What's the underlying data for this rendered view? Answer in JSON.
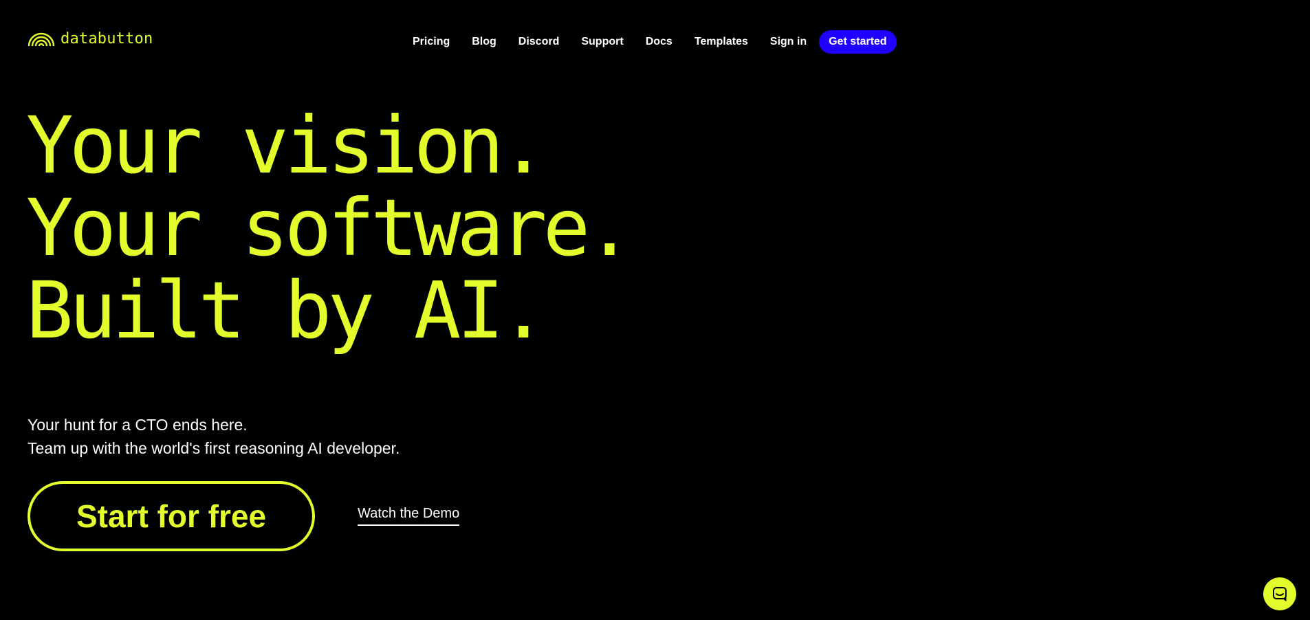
{
  "brand": {
    "name": "databutton",
    "accent_color": "#e3fc2c",
    "cta_color": "#2000ff",
    "logo_icon": "rainbow-arc-icon"
  },
  "nav": {
    "items": [
      {
        "label": "Pricing"
      },
      {
        "label": "Blog"
      },
      {
        "label": "Discord"
      },
      {
        "label": "Support"
      },
      {
        "label": "Docs"
      },
      {
        "label": "Templates"
      },
      {
        "label": "Sign in"
      }
    ],
    "cta_label": "Get started"
  },
  "hero": {
    "headline": [
      "Your vision.",
      "Your software.",
      "Built by AI."
    ],
    "subtext": [
      "Your hunt for a CTO ends here.",
      "Team up with the world's first reasoning AI developer."
    ],
    "primary_cta": "Start for free",
    "secondary_cta": "Watch the Demo"
  },
  "chat": {
    "icon": "chat-bubble-icon"
  }
}
